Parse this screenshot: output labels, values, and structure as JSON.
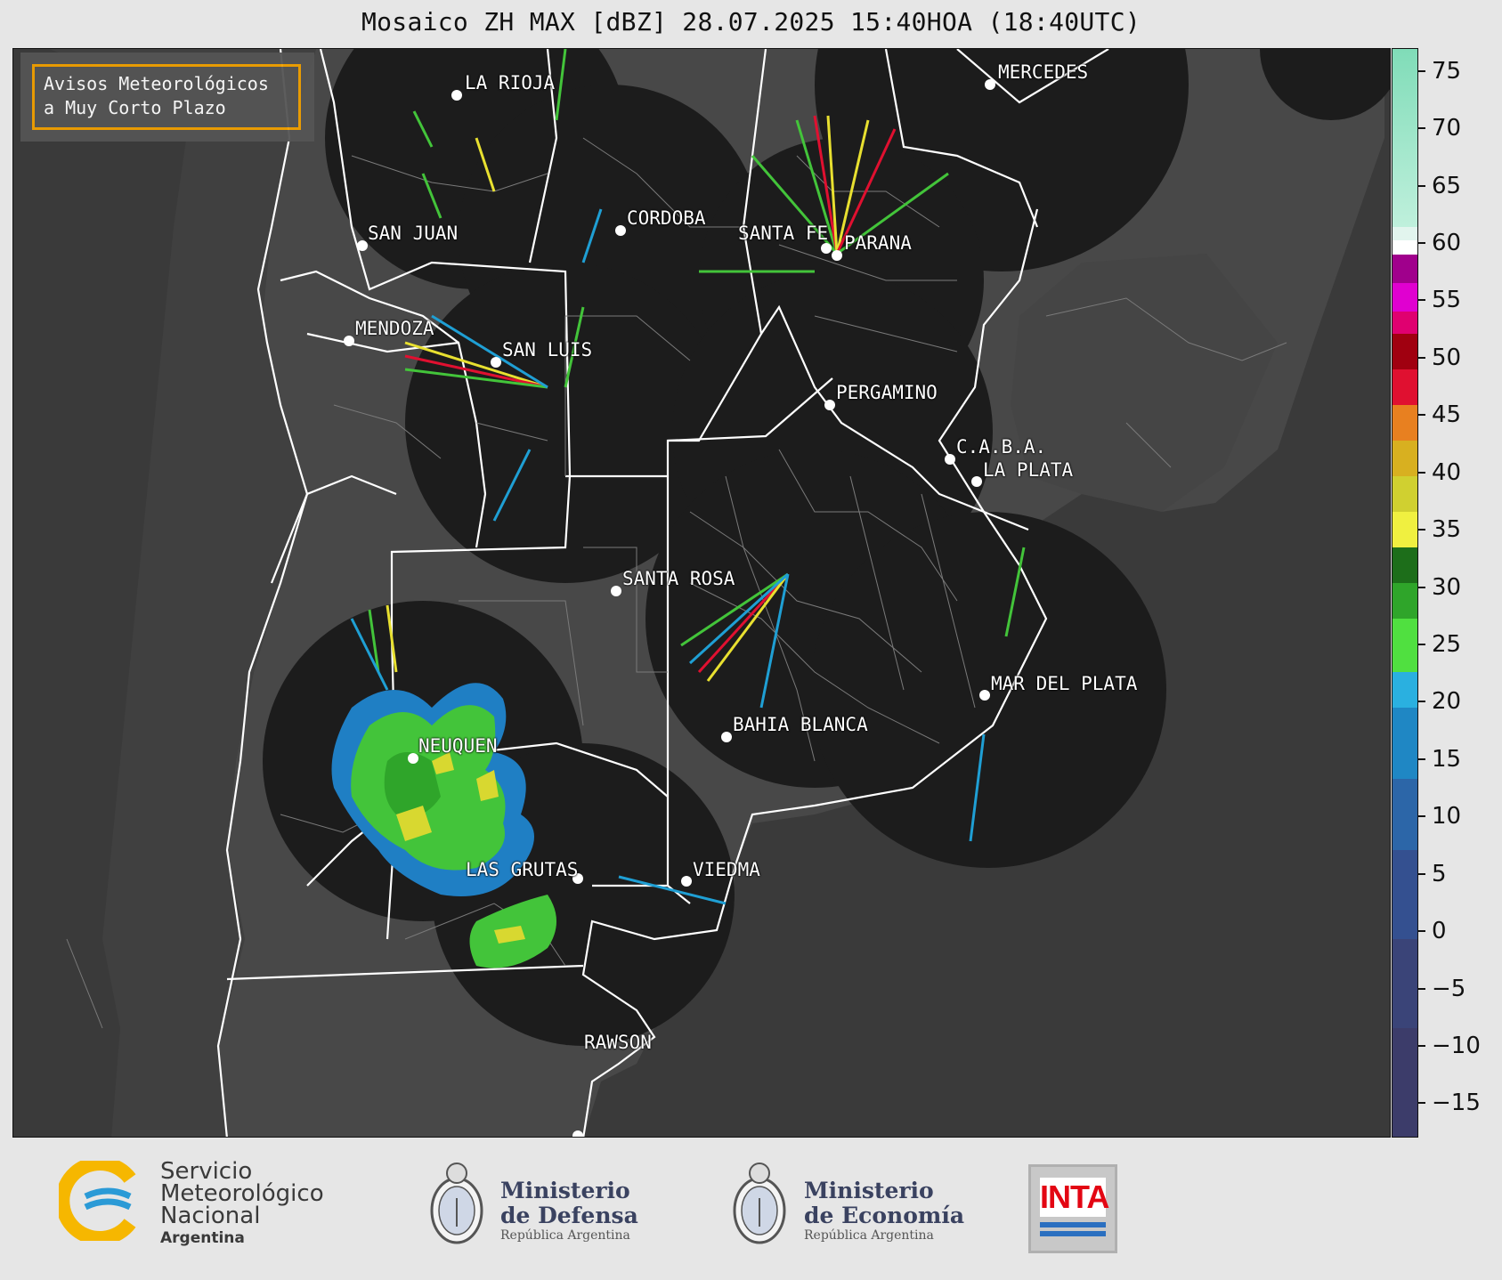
{
  "title": "Mosaico ZH MAX [dBZ] 28.07.2025 15:40HOA (18:40UTC)",
  "notice": {
    "line1": "Avisos Meteorológicos",
    "line2": "a Muy Corto Plazo"
  },
  "cities": [
    {
      "name": "LA RIOJA"
    },
    {
      "name": "MERCEDES"
    },
    {
      "name": "SAN JUAN"
    },
    {
      "name": "CORDOBA"
    },
    {
      "name": "SANTA FE"
    },
    {
      "name": "PARANA"
    },
    {
      "name": "MENDOZA"
    },
    {
      "name": "SAN LUIS"
    },
    {
      "name": "PERGAMINO"
    },
    {
      "name": "C.A.B.A."
    },
    {
      "name": "LA PLATA"
    },
    {
      "name": "SANTA ROSA"
    },
    {
      "name": "MAR DEL PLATA"
    },
    {
      "name": "BAHIA BLANCA"
    },
    {
      "name": "NEUQUEN"
    },
    {
      "name": "LAS GRUTAS"
    },
    {
      "name": "VIEDMA"
    },
    {
      "name": "RAWSON"
    }
  ],
  "colorbar": {
    "min": -18,
    "max": 77,
    "tick_labels": [
      "75",
      "70",
      "65",
      "60",
      "55",
      "50",
      "45",
      "40",
      "35",
      "30",
      "25",
      "20",
      "15",
      "10",
      "5",
      "0",
      "−5",
      "−10",
      "−15"
    ]
  },
  "colors": {
    "background": "#e6e6e6",
    "map_ocean": "#3a3a3a",
    "radar_disk": "#1c1c1c",
    "notice_border": "#f2a000"
  },
  "logos": {
    "smn": {
      "line1": "Servicio",
      "line2": "Meteorológico",
      "line3": "Nacional",
      "line4": "Argentina"
    },
    "defensa": {
      "line1": "Ministerio",
      "line2": "de Defensa",
      "line3": "República Argentina"
    },
    "economia": {
      "line1": "Ministerio",
      "line2": "de Economía",
      "line3": "República Argentina"
    },
    "inta": {
      "text": "INTA"
    }
  }
}
